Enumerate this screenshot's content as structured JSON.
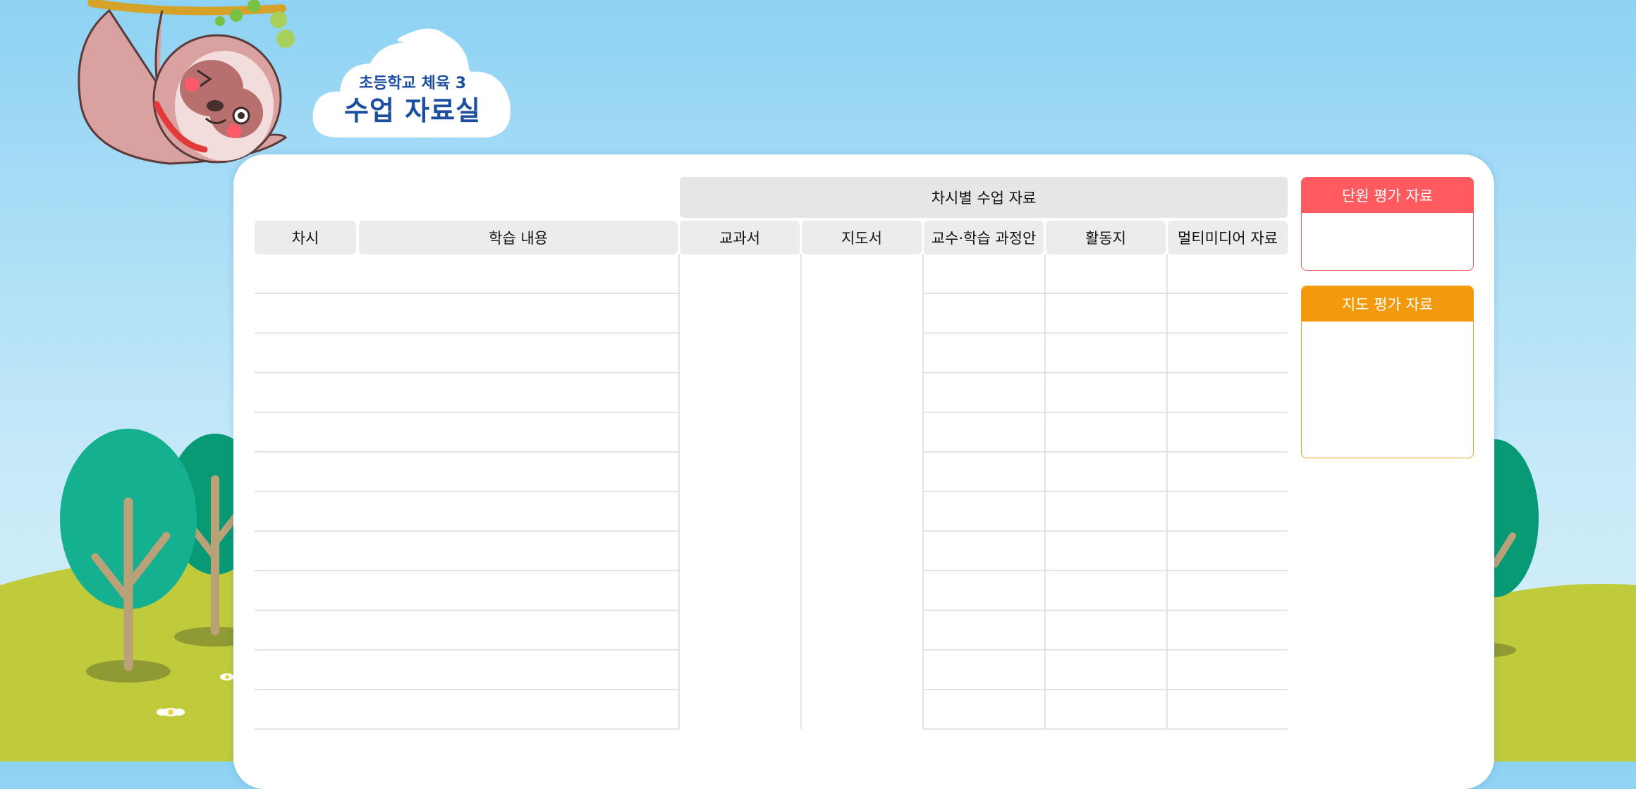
{
  "header": {
    "subtitle": "초등학교 체육 3",
    "title": "수업 자료실"
  },
  "table": {
    "section_header": "차시별 수업 자료",
    "columns": [
      "차시",
      "학습 내용",
      "교과서",
      "지도서",
      "교수·학습 과정안",
      "활동지",
      "멀티미디어 자료"
    ],
    "rows": [
      [
        "",
        "",
        "",
        "",
        "",
        "",
        ""
      ],
      [
        "",
        "",
        "",
        "",
        "",
        "",
        ""
      ],
      [
        "",
        "",
        "",
        "",
        "",
        "",
        ""
      ],
      [
        "",
        "",
        "",
        "",
        "",
        "",
        ""
      ],
      [
        "",
        "",
        "",
        "",
        "",
        "",
        ""
      ],
      [
        "",
        "",
        "",
        "",
        "",
        "",
        ""
      ],
      [
        "",
        "",
        "",
        "",
        "",
        "",
        ""
      ],
      [
        "",
        "",
        "",
        "",
        "",
        "",
        ""
      ],
      [
        "",
        "",
        "",
        "",
        "",
        "",
        ""
      ],
      [
        "",
        "",
        "",
        "",
        "",
        "",
        ""
      ],
      [
        "",
        "",
        "",
        "",
        "",
        "",
        ""
      ],
      [
        "",
        "",
        "",
        "",
        "",
        "",
        ""
      ]
    ]
  },
  "side_panels": {
    "unit_assessment": {
      "label": "단원 평가 자료",
      "color": "#ff5a5f"
    },
    "guidance_assessment": {
      "label": "지도 평가 자료",
      "color": "#f39a0c"
    }
  },
  "colors": {
    "sky": "#8ed2f3",
    "grass": "#bfcb3a",
    "title_blue": "#1d4ea0",
    "tree_green": "#15b08f"
  },
  "icons": [
    "sloth-mascot",
    "cloud-icon",
    "tree-icon",
    "flower-icon"
  ]
}
